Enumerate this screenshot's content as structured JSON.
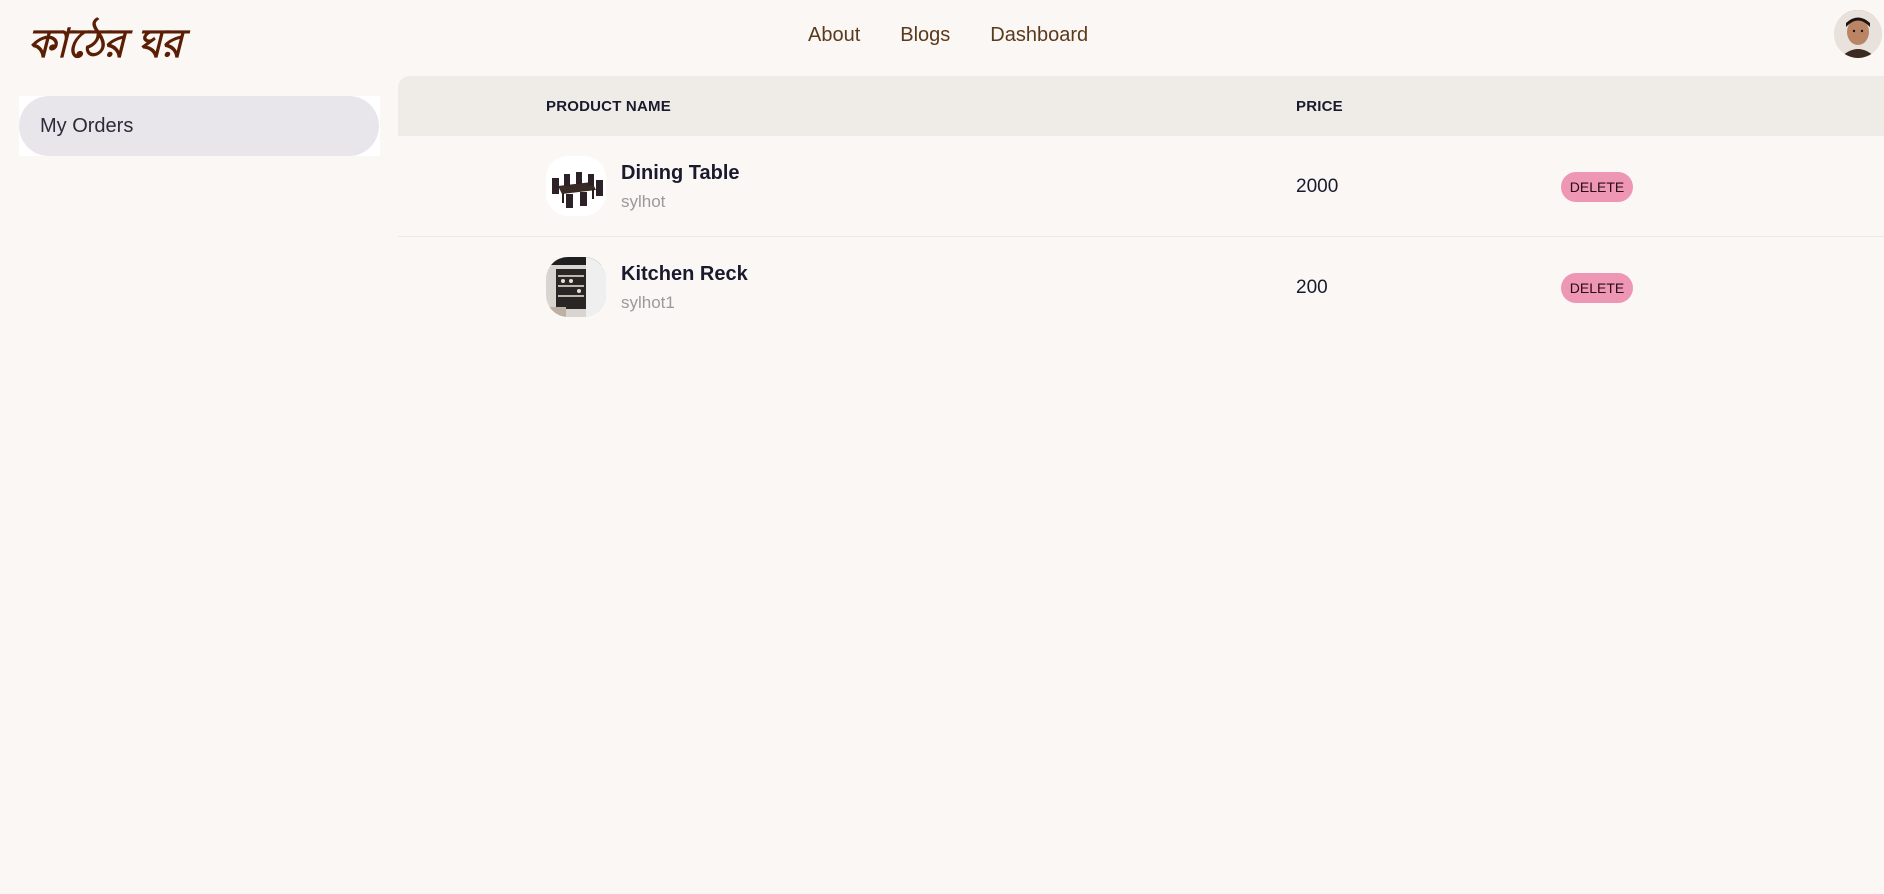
{
  "brand": {
    "logo_text": "কাঠের ঘর"
  },
  "nav": {
    "links": [
      "About",
      "Blogs",
      "Dashboard"
    ]
  },
  "sidebar": {
    "items": [
      {
        "label": "My Orders"
      }
    ]
  },
  "orders_table": {
    "headers": {
      "product_name": "PRODUCT NAME",
      "price": "PRICE"
    },
    "rows": [
      {
        "name": "Dining Table",
        "seller": "sylhot",
        "price": "2000",
        "action": "DELETE"
      },
      {
        "name": "Kitchen Reck",
        "seller": "sylhot1",
        "price": "200",
        "action": "DELETE"
      }
    ]
  },
  "colors": {
    "background": "#faf7f4",
    "brand": "#5a1e05",
    "nav_link": "#5b3a1c",
    "table_header": "#efebe7",
    "delete_button": "#ee97b5",
    "sidebar_active": "#e8e6ea"
  }
}
